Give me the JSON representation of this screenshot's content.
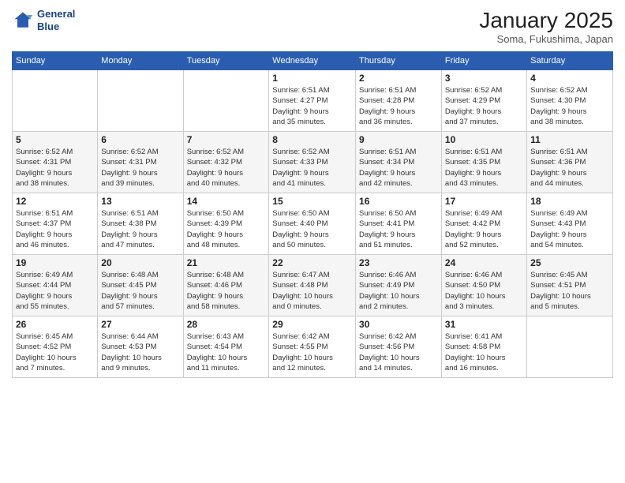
{
  "logo": {
    "line1": "General",
    "line2": "Blue"
  },
  "header": {
    "title": "January 2025",
    "subtitle": "Soma, Fukushima, Japan"
  },
  "weekdays": [
    "Sunday",
    "Monday",
    "Tuesday",
    "Wednesday",
    "Thursday",
    "Friday",
    "Saturday"
  ],
  "weeks": [
    [
      {
        "day": "",
        "info": ""
      },
      {
        "day": "",
        "info": ""
      },
      {
        "day": "",
        "info": ""
      },
      {
        "day": "1",
        "info": "Sunrise: 6:51 AM\nSunset: 4:27 PM\nDaylight: 9 hours\nand 35 minutes."
      },
      {
        "day": "2",
        "info": "Sunrise: 6:51 AM\nSunset: 4:28 PM\nDaylight: 9 hours\nand 36 minutes."
      },
      {
        "day": "3",
        "info": "Sunrise: 6:52 AM\nSunset: 4:29 PM\nDaylight: 9 hours\nand 37 minutes."
      },
      {
        "day": "4",
        "info": "Sunrise: 6:52 AM\nSunset: 4:30 PM\nDaylight: 9 hours\nand 38 minutes."
      }
    ],
    [
      {
        "day": "5",
        "info": "Sunrise: 6:52 AM\nSunset: 4:31 PM\nDaylight: 9 hours\nand 38 minutes."
      },
      {
        "day": "6",
        "info": "Sunrise: 6:52 AM\nSunset: 4:31 PM\nDaylight: 9 hours\nand 39 minutes."
      },
      {
        "day": "7",
        "info": "Sunrise: 6:52 AM\nSunset: 4:32 PM\nDaylight: 9 hours\nand 40 minutes."
      },
      {
        "day": "8",
        "info": "Sunrise: 6:52 AM\nSunset: 4:33 PM\nDaylight: 9 hours\nand 41 minutes."
      },
      {
        "day": "9",
        "info": "Sunrise: 6:51 AM\nSunset: 4:34 PM\nDaylight: 9 hours\nand 42 minutes."
      },
      {
        "day": "10",
        "info": "Sunrise: 6:51 AM\nSunset: 4:35 PM\nDaylight: 9 hours\nand 43 minutes."
      },
      {
        "day": "11",
        "info": "Sunrise: 6:51 AM\nSunset: 4:36 PM\nDaylight: 9 hours\nand 44 minutes."
      }
    ],
    [
      {
        "day": "12",
        "info": "Sunrise: 6:51 AM\nSunset: 4:37 PM\nDaylight: 9 hours\nand 46 minutes."
      },
      {
        "day": "13",
        "info": "Sunrise: 6:51 AM\nSunset: 4:38 PM\nDaylight: 9 hours\nand 47 minutes."
      },
      {
        "day": "14",
        "info": "Sunrise: 6:50 AM\nSunset: 4:39 PM\nDaylight: 9 hours\nand 48 minutes."
      },
      {
        "day": "15",
        "info": "Sunrise: 6:50 AM\nSunset: 4:40 PM\nDaylight: 9 hours\nand 50 minutes."
      },
      {
        "day": "16",
        "info": "Sunrise: 6:50 AM\nSunset: 4:41 PM\nDaylight: 9 hours\nand 51 minutes."
      },
      {
        "day": "17",
        "info": "Sunrise: 6:49 AM\nSunset: 4:42 PM\nDaylight: 9 hours\nand 52 minutes."
      },
      {
        "day": "18",
        "info": "Sunrise: 6:49 AM\nSunset: 4:43 PM\nDaylight: 9 hours\nand 54 minutes."
      }
    ],
    [
      {
        "day": "19",
        "info": "Sunrise: 6:49 AM\nSunset: 4:44 PM\nDaylight: 9 hours\nand 55 minutes."
      },
      {
        "day": "20",
        "info": "Sunrise: 6:48 AM\nSunset: 4:45 PM\nDaylight: 9 hours\nand 57 minutes."
      },
      {
        "day": "21",
        "info": "Sunrise: 6:48 AM\nSunset: 4:46 PM\nDaylight: 9 hours\nand 58 minutes."
      },
      {
        "day": "22",
        "info": "Sunrise: 6:47 AM\nSunset: 4:48 PM\nDaylight: 10 hours\nand 0 minutes."
      },
      {
        "day": "23",
        "info": "Sunrise: 6:46 AM\nSunset: 4:49 PM\nDaylight: 10 hours\nand 2 minutes."
      },
      {
        "day": "24",
        "info": "Sunrise: 6:46 AM\nSunset: 4:50 PM\nDaylight: 10 hours\nand 3 minutes."
      },
      {
        "day": "25",
        "info": "Sunrise: 6:45 AM\nSunset: 4:51 PM\nDaylight: 10 hours\nand 5 minutes."
      }
    ],
    [
      {
        "day": "26",
        "info": "Sunrise: 6:45 AM\nSunset: 4:52 PM\nDaylight: 10 hours\nand 7 minutes."
      },
      {
        "day": "27",
        "info": "Sunrise: 6:44 AM\nSunset: 4:53 PM\nDaylight: 10 hours\nand 9 minutes."
      },
      {
        "day": "28",
        "info": "Sunrise: 6:43 AM\nSunset: 4:54 PM\nDaylight: 10 hours\nand 11 minutes."
      },
      {
        "day": "29",
        "info": "Sunrise: 6:42 AM\nSunset: 4:55 PM\nDaylight: 10 hours\nand 12 minutes."
      },
      {
        "day": "30",
        "info": "Sunrise: 6:42 AM\nSunset: 4:56 PM\nDaylight: 10 hours\nand 14 minutes."
      },
      {
        "day": "31",
        "info": "Sunrise: 6:41 AM\nSunset: 4:58 PM\nDaylight: 10 hours\nand 16 minutes."
      },
      {
        "day": "",
        "info": ""
      }
    ]
  ]
}
